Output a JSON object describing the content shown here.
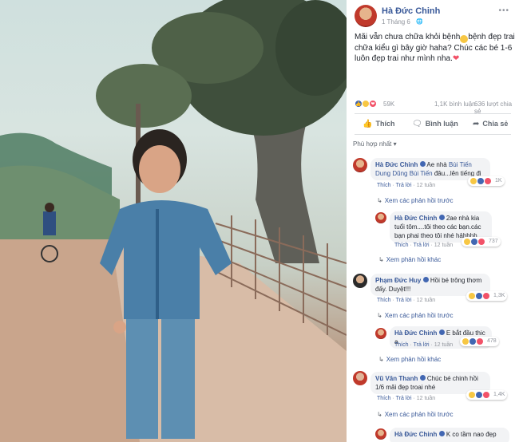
{
  "post": {
    "author": "Hà Đức Chinh",
    "date": "1 Tháng 6",
    "privacy_icon": "globe-icon",
    "caption_part1": "Mãi vẫn chưa chữa khỏi bệnh",
    "caption_part2": "bệnh đẹp trai chữa kiểu gì bây giờ haha? Chúc các bé 1-6 luôn đẹp trai như mình nha.",
    "reaction_count": "59K",
    "comments_count": "1,1K bình luận",
    "shares_count": "636 lượt chia sẻ",
    "like_label": "Thích",
    "comment_label": "Bình luận",
    "share_label": "Chia sẻ",
    "sort_label": "Phù hợp nhất ▾"
  },
  "comments": [
    {
      "name": "Hà Đức Chinh",
      "text_pre": "Ae nhà",
      "mention": "Bùi Tiến Dung Dũng Bùi Tiến",
      "text_post": "đâu...lên tiếng đi",
      "like": "Thích",
      "reply": "Trả lời",
      "time": "12 tuần",
      "reactions": "1K",
      "more": "Xem các phản hồi trước"
    },
    {
      "name": "Hà Đức Chinh",
      "text": "2ae nhà kia tuổi tôm....tôi theo các bạn.các bạn phai theo tôi nhé hảhhhh",
      "like": "Thích",
      "reply": "Trả lời",
      "time": "12 tuần",
      "reactions": "737",
      "more": "Xem phản hồi khác"
    },
    {
      "name": "Phạm Đức Huy",
      "text": "Hồi bé trông thơm đấy. Duyệt!!!",
      "like": "Thích",
      "reply": "Trả lời",
      "time": "12 tuần",
      "reactions": "1,3K",
      "more": "Xem các phản hồi trước"
    },
    {
      "name": "Hà Đức Chinh",
      "text": "E bắt đầu thic a",
      "like": "Thích",
      "reply": "Trả lời",
      "time": "12 tuần",
      "reactions": "478",
      "more": "Xem phản hồi khác"
    },
    {
      "name": "Vũ Văn Thanh",
      "text": "Chúc bé chinh hồi 1/6 mãi đẹp troai nhé",
      "like": "Thích",
      "reply": "Trả lời",
      "time": "12 tuần",
      "reactions": "1,4K",
      "more": "Xem các phản hồi trước"
    },
    {
      "name": "Hà Đức Chinh",
      "text": "K co tầm nao đẹp"
    }
  ],
  "colors": {
    "link": "#385898",
    "like_blue": "#4267b2",
    "love_red": "#f25268",
    "haha_yellow": "#f7c744"
  }
}
